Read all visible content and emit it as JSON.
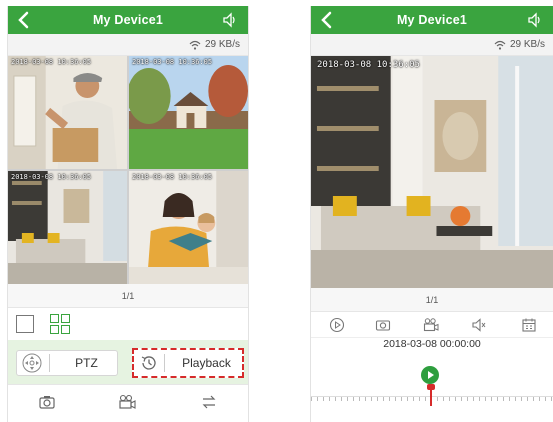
{
  "left": {
    "title": "My Device1",
    "network_rate": "29 KB/s",
    "tiles": [
      {
        "timestamp": "2018-03-08 10:36:05"
      },
      {
        "timestamp": "2018-03-08 10:36:05"
      },
      {
        "timestamp": "2018-03-08 10:36:05"
      },
      {
        "timestamp": "2018-03-08 10:36:05"
      }
    ],
    "page_indicator": "1/1",
    "ptz_label": "PTZ",
    "playback_label": "Playback"
  },
  "right": {
    "title": "My Device1",
    "network_rate": "29 KB/s",
    "timestamp": "2018-03-08 10:36:05",
    "page_indicator": "1/1",
    "playback_date": "2018-03-08 00:00:00"
  },
  "colors": {
    "accent": "#3aa43f",
    "highlight": "#d62b2b",
    "action_bg": "#e6f3e1"
  },
  "icons": {
    "back": "chevron-left-icon",
    "speaker": "speaker-icon",
    "wifi": "wifi-icon",
    "camera": "camera-icon",
    "record": "video-record-icon",
    "switch": "switch-arrows-icon"
  }
}
